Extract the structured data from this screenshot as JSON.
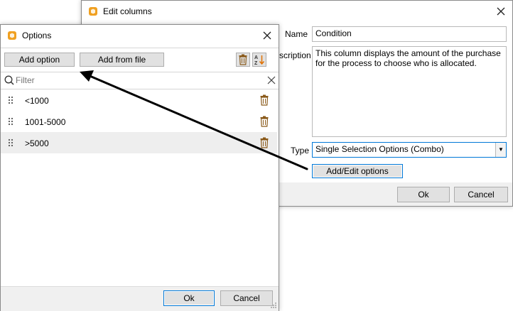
{
  "edit_columns": {
    "title": "Edit columns",
    "name_label": "Name",
    "name_value": "Condition",
    "description_label": "scription",
    "description_value": "This column displays the amount of the purchase for the process to choose who is allocated.",
    "type_label": "Type",
    "type_value": "Single Selection Options (Combo)",
    "add_edit_label": "Add/Edit options",
    "ok_label": "Ok",
    "cancel_label": "Cancel"
  },
  "options": {
    "title": "Options",
    "add_option_label": "Add option",
    "add_from_file_label": "Add from file",
    "filter_placeholder": "Filter",
    "items": [
      {
        "label": "<1000"
      },
      {
        "label": "1001-5000"
      },
      {
        "label": ">5000"
      }
    ],
    "ok_label": "Ok",
    "cancel_label": "Cancel"
  },
  "colors": {
    "accent": "#0078d7",
    "icon_orange": "#f0a020",
    "trash_brown": "#8a5a1a",
    "selected_row": "#eeeeee"
  }
}
